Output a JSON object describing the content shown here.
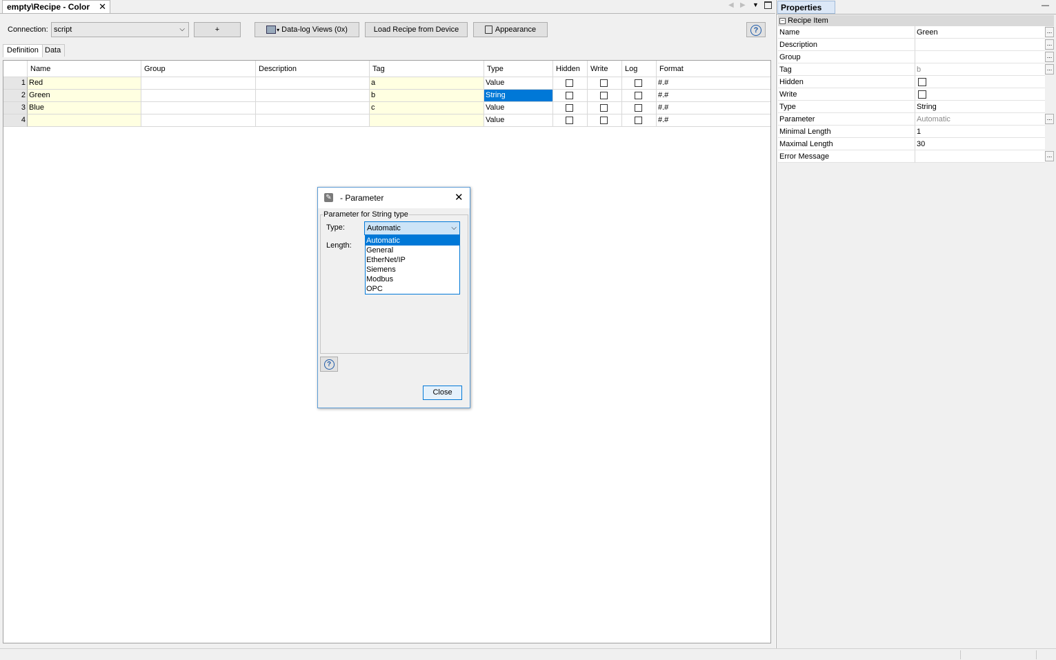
{
  "document_tab": {
    "title": "empty\\Recipe - Color",
    "close": "✕"
  },
  "toolbar": {
    "connection_label": "Connection:",
    "connection_value": "script",
    "add_label": "+",
    "datalog_label": "Data-log Views (0x)",
    "load_recipe_label": "Load Recipe from Device",
    "appearance_label": "Appearance",
    "help_glyph": "?"
  },
  "subtabs": [
    "Definition",
    "Data"
  ],
  "grid": {
    "columns": [
      "Name",
      "Group",
      "Description",
      "Tag",
      "Type",
      "Hidden",
      "Write",
      "Log",
      "Format"
    ],
    "rows": [
      {
        "num": "1",
        "name": "Red",
        "group": "",
        "description": "",
        "tag": "a",
        "type": "Value",
        "hidden": false,
        "write": false,
        "log": false,
        "format": "#.#"
      },
      {
        "num": "2",
        "name": "Green",
        "group": "",
        "description": "",
        "tag": "b",
        "type": "String",
        "hidden": false,
        "write": false,
        "log": false,
        "format": "#.#"
      },
      {
        "num": "3",
        "name": "Blue",
        "group": "",
        "description": "",
        "tag": "c",
        "type": "Value",
        "hidden": false,
        "write": false,
        "log": false,
        "format": "#.#"
      },
      {
        "num": "4",
        "name": "",
        "group": "",
        "description": "",
        "tag": "",
        "type": "Value",
        "hidden": false,
        "write": false,
        "log": false,
        "format": "#.#"
      }
    ]
  },
  "properties": {
    "title": "Properties",
    "minimize": "—",
    "section": "Recipe Item",
    "items": [
      {
        "label": "Name",
        "value": "Green"
      },
      {
        "label": "Description",
        "value": ""
      },
      {
        "label": "Group",
        "value": ""
      },
      {
        "label": "Tag",
        "value": "b"
      },
      {
        "label": "Hidden",
        "value": ""
      },
      {
        "label": "Write",
        "value": ""
      },
      {
        "label": "Type",
        "value": "String"
      },
      {
        "label": "Parameter",
        "value": "Automatic"
      },
      {
        "label": "Minimal Length",
        "value": "1"
      },
      {
        "label": "Maximal Length",
        "value": "30"
      },
      {
        "label": "Error Message",
        "value": ""
      }
    ]
  },
  "dialog": {
    "title": "- Parameter",
    "group_label": "Parameter for String type",
    "type_label": "Type:",
    "length_label": "Length:",
    "type_value": "Automatic",
    "options": [
      "Automatic",
      "General",
      "EtherNet/IP",
      "Siemens",
      "Modbus",
      "OPC"
    ],
    "close_label": "Close",
    "help_glyph": "?"
  },
  "colors": {
    "accent": "#0078d7",
    "editable_cell": "#ffffe1",
    "dialog_border": "#5a9bd5"
  }
}
